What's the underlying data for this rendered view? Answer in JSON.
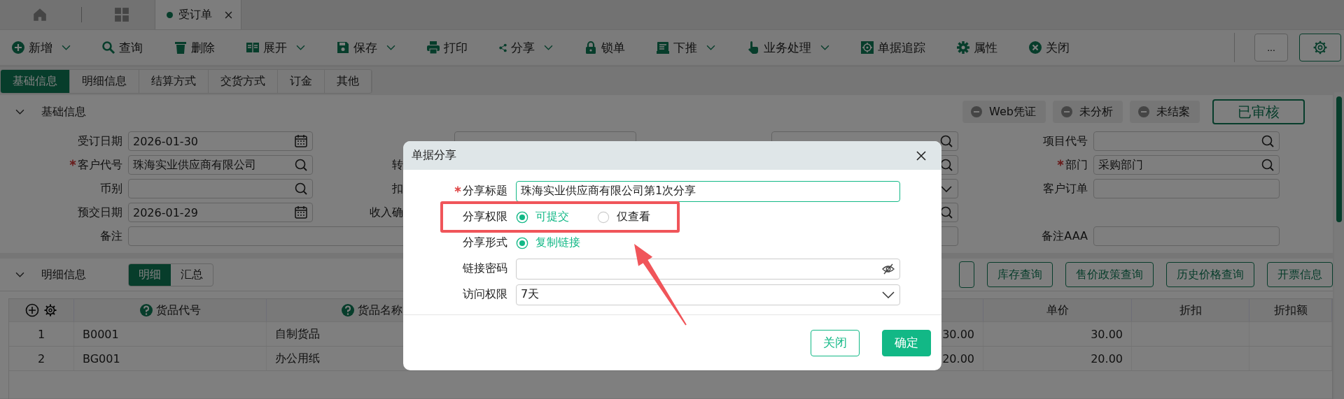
{
  "top_tabs": [
    {
      "label": "受订单",
      "selected": true
    }
  ],
  "toolbar": [
    {
      "kind": "add",
      "label": "新增",
      "dropdown": true
    },
    {
      "kind": "search",
      "label": "查询",
      "dropdown": false
    },
    {
      "kind": "delete",
      "label": "删除",
      "dropdown": false
    },
    {
      "kind": "expand",
      "label": "展开",
      "dropdown": true
    },
    {
      "kind": "save",
      "label": "保存",
      "dropdown": true
    },
    {
      "kind": "print",
      "label": "打印",
      "dropdown": false
    },
    {
      "kind": "share",
      "label": "分享",
      "dropdown": true
    },
    {
      "kind": "lock",
      "label": "锁单",
      "dropdown": false
    },
    {
      "kind": "push",
      "label": "下推",
      "dropdown": true
    },
    {
      "kind": "process",
      "label": "业务处理",
      "dropdown": true
    },
    {
      "kind": "track",
      "label": "单据追踪",
      "dropdown": false
    },
    {
      "kind": "props",
      "label": "属性",
      "dropdown": false
    },
    {
      "kind": "close",
      "label": "关闭",
      "dropdown": false
    }
  ],
  "more_button": "...",
  "form_tabs": [
    {
      "label": "基础信息",
      "selected": true
    },
    {
      "label": "明细信息",
      "selected": false
    },
    {
      "label": "结算方式",
      "selected": false
    },
    {
      "label": "交货方式",
      "selected": false
    },
    {
      "label": "订金",
      "selected": false
    },
    {
      "label": "其他",
      "selected": false
    }
  ],
  "basic_section": {
    "title": "基础信息",
    "expanded": true,
    "statuses": [
      {
        "label": "Web凭证",
        "approved": false
      },
      {
        "label": "未分析",
        "approved": false
      },
      {
        "label": "未结案",
        "approved": false
      },
      {
        "label": "已审核",
        "approved": true
      }
    ],
    "rows": [
      [
        {
          "kind": "date",
          "label": "受订日期",
          "required": false,
          "value": "2026-01-30"
        },
        {
          "kind": "plain"
        },
        {
          "kind": "search"
        },
        {
          "kind": "search",
          "label": "项目代号",
          "required": false
        }
      ],
      [
        {
          "kind": "search",
          "label": "客户代号",
          "required": true,
          "value": "珠海实业供应商有限公司"
        },
        {
          "kind": "none",
          "label": "转",
          "required": false
        },
        {
          "kind": "search"
        },
        {
          "kind": "search",
          "label": "部门",
          "required": true,
          "value": "采购部门"
        }
      ],
      [
        {
          "kind": "search",
          "label": "币别",
          "required": false
        },
        {
          "kind": "plain",
          "label": "扣",
          "required": false
        },
        {
          "kind": "select"
        },
        {
          "kind": "plain",
          "label": "客户订单",
          "required": false
        }
      ],
      [
        {
          "kind": "date",
          "label": "预交日期",
          "required": false,
          "value": "2026-01-29"
        },
        {
          "kind": "none",
          "label": "收入确",
          "required": false
        },
        {
          "kind": "search"
        },
        {
          "kind": "none"
        }
      ],
      [
        {
          "kind": "wide",
          "label": "备注",
          "required": false
        },
        "",
        "",
        {
          "kind": "plain",
          "label": "备注AAA",
          "required": false
        }
      ]
    ]
  },
  "detail_section": {
    "title": "明细信息",
    "expanded": true,
    "views": [
      {
        "label": "明细",
        "selected": true
      },
      {
        "label": "汇总",
        "selected": false
      }
    ],
    "buttons": [
      "库存查询",
      "售价政策查询",
      "历史价格查询",
      "开票信息"
    ],
    "table": {
      "columns": [
        {
          "kind": "tools"
        },
        {
          "kind": "text",
          "label": "货品代号",
          "help": true
        },
        {
          "kind": "text",
          "label": "货品名称",
          "help": true
        },
        {
          "kind": "blank"
        },
        {
          "kind": "blank"
        },
        {
          "kind": "text",
          "label": "单价",
          "help": false
        },
        {
          "kind": "text",
          "label": "折扣",
          "help": false
        },
        {
          "kind": "text",
          "label": "折扣额",
          "help": false
        }
      ],
      "rows": [
        {
          "no": "1",
          "code": "B0001",
          "name": "自制货品",
          "column_5": "30.00",
          "price": "30.00"
        },
        {
          "no": "2",
          "code": "BG001",
          "name": "办公用纸",
          "column_5": "20.00",
          "price": "20.00"
        }
      ]
    }
  },
  "dialog": {
    "title": "单据分享",
    "fields": [
      {
        "kind": "text",
        "label": "分享标题",
        "required": true,
        "highlighted": false,
        "value": "珠海实业供应商有限公司第1次分享"
      },
      {
        "kind": "radio",
        "label": "分享权限",
        "required": false,
        "highlighted": true,
        "options": [
          {
            "label": "可提交",
            "selected": true
          },
          {
            "label": "仅查看",
            "selected": false
          }
        ]
      },
      {
        "kind": "radio",
        "label": "分享形式",
        "required": false,
        "highlighted": false,
        "options": [
          {
            "label": "复制链接",
            "selected": true
          }
        ]
      },
      {
        "kind": "password",
        "label": "链接密码",
        "required": false,
        "highlighted": false
      },
      {
        "kind": "select",
        "label": "访问权限",
        "required": false,
        "highlighted": false,
        "value": "7天"
      }
    ],
    "buttons": [
      {
        "kind": "secondary",
        "label": "关闭"
      },
      {
        "kind": "primary",
        "label": "确定"
      }
    ]
  }
}
